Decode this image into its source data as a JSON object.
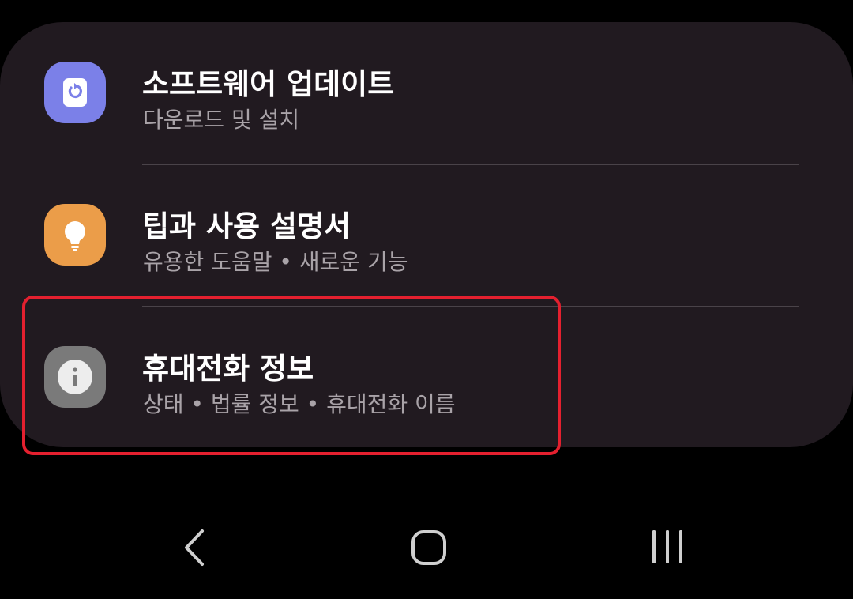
{
  "settings_list": {
    "items": [
      {
        "id": "software-update",
        "title": "소프트웨어 업데이트",
        "subtitle": "다운로드 및 설치",
        "icon": "software-update-icon",
        "icon_color": "#7b80e8"
      },
      {
        "id": "tips",
        "title": "팁과 사용 설명서",
        "subtitle": "유용한 도움말 • 새로운 기능",
        "icon": "lightbulb-icon",
        "icon_color": "#eb9d49"
      },
      {
        "id": "about-phone",
        "title": "휴대전화 정보",
        "subtitle": "상태 • 법률 정보 • 휴대전화 이름",
        "icon": "info-icon",
        "icon_color": "#7a7a7a"
      }
    ]
  },
  "highlight": {
    "target": "about-phone",
    "color": "#e4202f"
  },
  "nav_bar": {
    "buttons": [
      "back-icon",
      "home-icon",
      "recents-icon"
    ]
  }
}
